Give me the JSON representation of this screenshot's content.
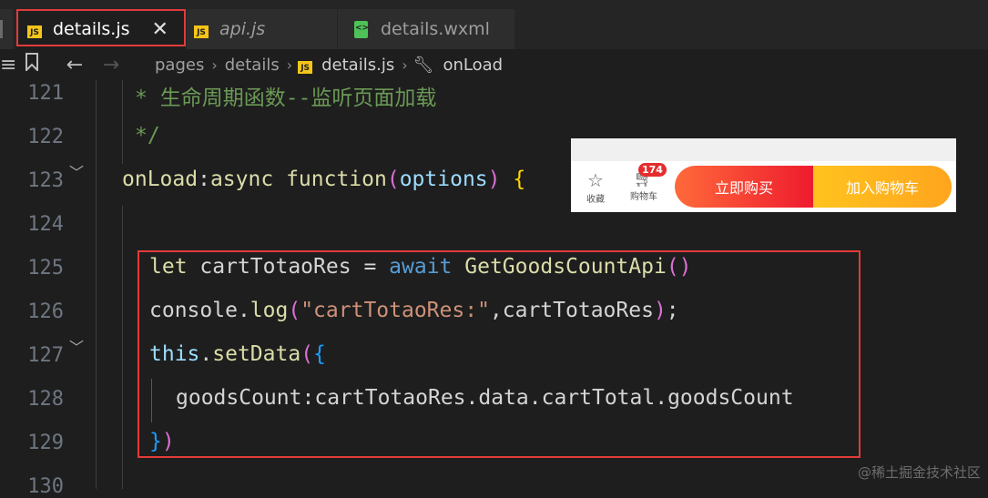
{
  "tabs": [
    {
      "label": "details.js",
      "icon": "JS",
      "active": true
    },
    {
      "label": "api.js",
      "icon": "JS",
      "active": false
    },
    {
      "label": "details.wxml",
      "icon": "wxml",
      "active": false
    }
  ],
  "breadcrumb": {
    "items": [
      "pages",
      "details",
      "details.js",
      "onLoad"
    ]
  },
  "editor": {
    "line_numbers": [
      "121",
      "122",
      "123",
      "124",
      "125",
      "126",
      "127",
      "128",
      "129",
      "130"
    ],
    "lines": {
      "l121": "* 生命周期函数--监听页面加载",
      "l122": "*/",
      "l123_name": "onLoad",
      "l123_colon": ":",
      "l123_async": "async",
      "l123_function": "function",
      "l123_open": "(",
      "l123_param": "options",
      "l123_close": ")",
      "l123_brace": "{",
      "l125_let": "let",
      "l125_var": "cartTotaoRes",
      "l125_eq": "=",
      "l125_await": "await",
      "l125_fn": "GetGoodsCountApi",
      "l125_parens": "()",
      "l126_console": "console",
      "l126_dot": ".",
      "l126_log": "log",
      "l126_open": "(",
      "l126_str": "\"cartTotaoRes:\"",
      "l126_rest": ",cartTotaoRes",
      "l126_close": ")",
      "l126_semi": ";",
      "l127_this": "this",
      "l127_dot": ".",
      "l127_fn": "setData",
      "l127_open": "(",
      "l127_brace": "{",
      "l128_key": "goodsCount",
      "l128_colon": ":",
      "l128_expr": "cartTotaoRes.data.cartTotal.goodsCount",
      "l129_brace": "}",
      "l129_paren": ")"
    }
  },
  "inset": {
    "fav_label": "收藏",
    "cart_label": "购物车",
    "badge": "174",
    "buy_now": "立即购买",
    "add_cart": "加入购物车"
  },
  "watermark": "@稀土掘金技术社区"
}
